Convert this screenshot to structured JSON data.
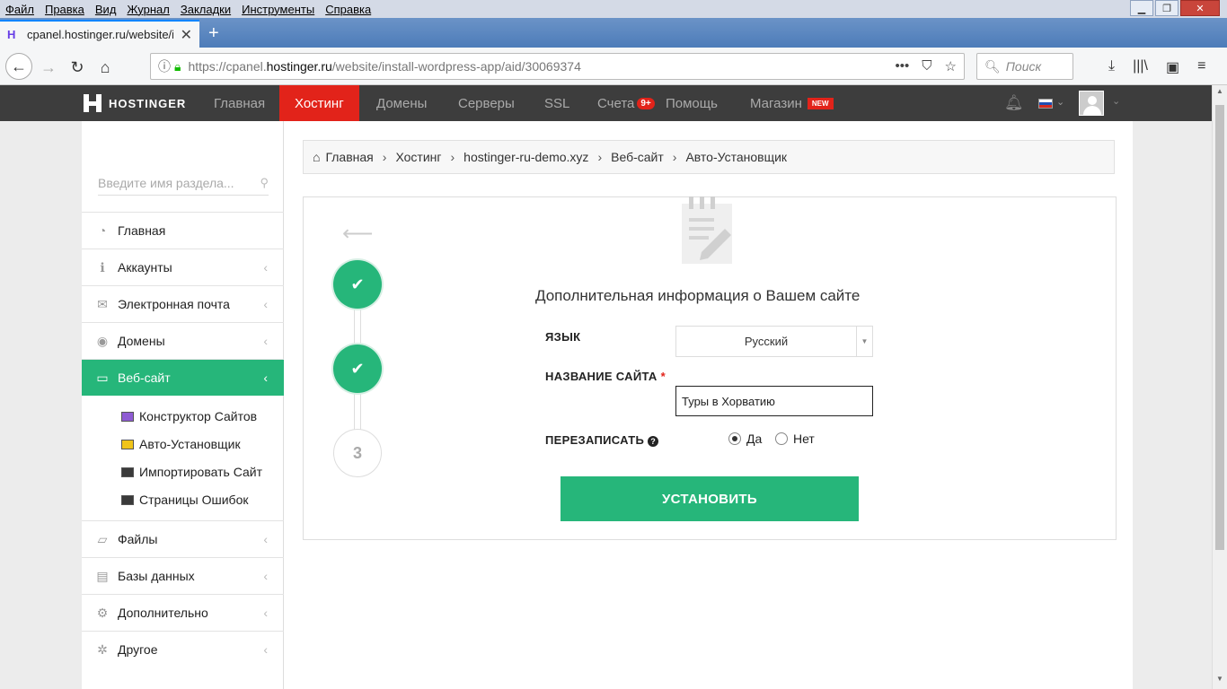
{
  "browser": {
    "menu": [
      "Файл",
      "Правка",
      "Вид",
      "Журнал",
      "Закладки",
      "Инструменты",
      "Справка"
    ],
    "tab_title": "cpanel.hostinger.ru/website/in",
    "url_prefix": "https://cpanel.",
    "url_host": "hostinger.ru",
    "url_path": "/website/install-wordpress-app/aid/30069374",
    "search_placeholder": "Поиск"
  },
  "topnav": {
    "logo": "HOSTINGER",
    "items": [
      "Главная",
      "Хостинг",
      "Домены",
      "Серверы",
      "SSL",
      "Счета",
      "Помощь",
      "Магазин"
    ],
    "active": "Хостинг",
    "invoices_badge": "9+",
    "shop_badge": "NEW"
  },
  "sidebar": {
    "search_placeholder": "Введите имя раздела...",
    "items": [
      {
        "label": "Главная",
        "icon": "dashboard-icon"
      },
      {
        "label": "Аккаунты",
        "icon": "info-icon"
      },
      {
        "label": "Электронная почта",
        "icon": "envelope-icon"
      },
      {
        "label": "Домены",
        "icon": "globe-icon"
      },
      {
        "label": "Веб-сайт",
        "icon": "monitor-icon",
        "active": true
      },
      {
        "label": "Файлы",
        "icon": "folder-icon"
      },
      {
        "label": "Базы данных",
        "icon": "database-icon"
      },
      {
        "label": "Дополнительно",
        "icon": "gears-icon"
      },
      {
        "label": "Другое",
        "icon": "gear-icon"
      }
    ],
    "subitems": [
      "Конструктор Сайтов",
      "Авто-Установщик",
      "Импортировать Сайт",
      "Страницы Ошибок"
    ]
  },
  "breadcrumb": [
    "Главная",
    "Хостинг",
    "hostinger-ru-demo.xyz",
    "Веб-сайт",
    "Авто-Установщик"
  ],
  "form": {
    "title_a": "Дополнительная информация",
    "title_b": " о Вашем сайте",
    "language_label": "ЯЗЫК",
    "language_value": "Русский",
    "sitename_label": "НАЗВАНИЕ САЙТА",
    "sitename_value": "Туры в Хорватию",
    "overwrite_label": "ПЕРЕЗАПИСАТЬ",
    "overwrite_yes": "Да",
    "overwrite_no": "Нет",
    "overwrite_selected": "Да",
    "install_button": "УСТАНОВИТЬ",
    "step3_label": "3"
  },
  "colors": {
    "accent": "#26b67a",
    "nav_active": "#e2231a",
    "nav_bg": "#3d3d3d"
  }
}
